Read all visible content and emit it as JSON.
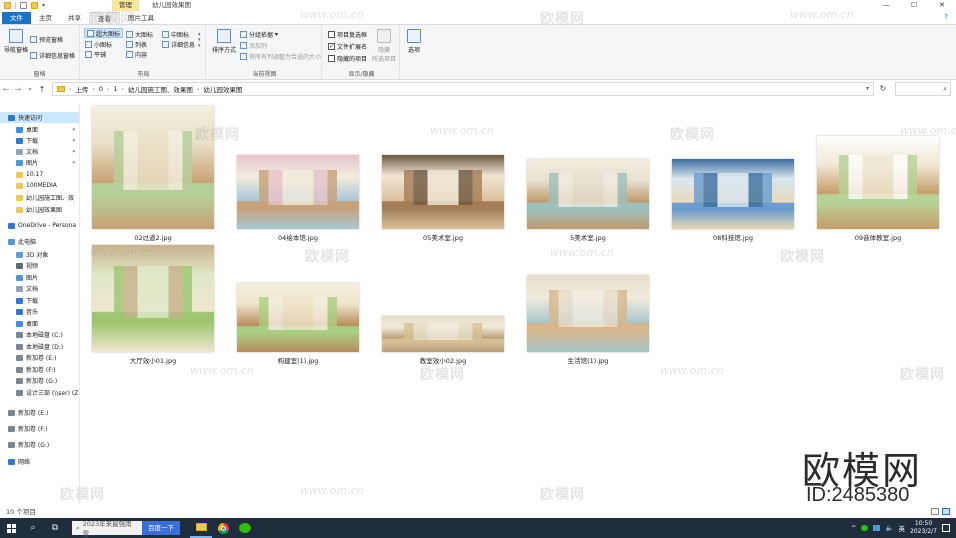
{
  "window": {
    "title": "幼儿园效果图",
    "manage_tab": "管理",
    "controls": [
      "—",
      "☐",
      "✕"
    ]
  },
  "ribbon": {
    "tabs": [
      "文件",
      "主页",
      "共享",
      "查看",
      "图片工具"
    ],
    "active_tab": "查看",
    "help": "?",
    "groups": {
      "pane": {
        "label": "窗格",
        "nav_pane": "导航窗格",
        "preview": "预览窗格",
        "details": "详细信息窗格"
      },
      "layout": {
        "label": "布局",
        "items": [
          "超大图标",
          "大图标",
          "中图标",
          "小图标",
          "列表",
          "详细信息",
          "平铺",
          "内容"
        ],
        "selected": "超大图标"
      },
      "current_view": {
        "label": "当前视图",
        "sort": "排序方式",
        "group_by": "分组依据",
        "add_column": "添加列",
        "fit_columns": "将所有列调整为合适的大小"
      },
      "show_hide": {
        "label": "显示/隐藏",
        "item_checkboxes": "项目复选框",
        "item_checkboxes_checked": false,
        "file_ext": "文件扩展名",
        "file_ext_checked": true,
        "hidden_items": "隐藏的项目",
        "hidden_items_checked": false,
        "hide": "隐藏",
        "hide_selected": "所选项目"
      },
      "options": {
        "label": "选项"
      }
    }
  },
  "address": {
    "breadcrumbs": [
      "上传",
      "0",
      "1",
      "幼儿园施工图、效果图",
      "幼儿园效果图"
    ],
    "search_placeholder": ""
  },
  "nav_pane": {
    "items": [
      {
        "label": "快速访问",
        "icon": "star-icon",
        "color": "#2b7bd6",
        "indent": 0,
        "active": true
      },
      {
        "label": "桌面",
        "icon": "desktop-icon",
        "color": "#3d8fe0",
        "indent": 1,
        "pinned": true
      },
      {
        "label": "下载",
        "icon": "download-icon",
        "color": "#2b7bd6",
        "indent": 1,
        "pinned": true
      },
      {
        "label": "文档",
        "icon": "document-icon",
        "color": "#8ea3b9",
        "indent": 1,
        "pinned": true
      },
      {
        "label": "图片",
        "icon": "picture-icon",
        "color": "#4a9ad8",
        "indent": 1,
        "pinned": true
      },
      {
        "label": "10.17",
        "icon": "folder-icon",
        "color": "#f3c94d",
        "indent": 1
      },
      {
        "label": "100MEDIA",
        "icon": "folder-icon",
        "color": "#f3c94d",
        "indent": 1
      },
      {
        "label": "幼儿园施工图、效",
        "icon": "folder-icon",
        "color": "#f3c94d",
        "indent": 1
      },
      {
        "label": "幼儿园效果图",
        "icon": "folder-icon",
        "color": "#f3c94d",
        "indent": 1
      },
      {
        "label": "OneDrive - Persona",
        "icon": "cloud-icon",
        "color": "#2b7bd6",
        "indent": 0
      },
      {
        "label": "此电脑",
        "icon": "computer-icon",
        "color": "#4a9ad8",
        "indent": 0
      },
      {
        "label": "3D 对象",
        "icon": "cube-icon",
        "color": "#5aa0e0",
        "indent": 1
      },
      {
        "label": "视频",
        "icon": "video-icon",
        "color": "#5a6b7c",
        "indent": 1
      },
      {
        "label": "图片",
        "icon": "picture-icon",
        "color": "#4a9ad8",
        "indent": 1
      },
      {
        "label": "文档",
        "icon": "document-icon",
        "color": "#8ea3b9",
        "indent": 1
      },
      {
        "label": "下载",
        "icon": "download-icon",
        "color": "#2b7bd6",
        "indent": 1
      },
      {
        "label": "音乐",
        "icon": "music-icon",
        "color": "#2b7bd6",
        "indent": 1
      },
      {
        "label": "桌面",
        "icon": "desktop-icon",
        "color": "#3d8fe0",
        "indent": 1
      },
      {
        "label": "本地磁盘 (C:)",
        "icon": "drive-icon",
        "color": "#7a8896",
        "indent": 1
      },
      {
        "label": "本地磁盘 (D:)",
        "icon": "drive-icon",
        "color": "#7a8896",
        "indent": 1
      },
      {
        "label": "新加卷 (E:)",
        "icon": "drive-icon",
        "color": "#7a8896",
        "indent": 1
      },
      {
        "label": "新加卷 (F:)",
        "icon": "drive-icon",
        "color": "#7a8896",
        "indent": 1
      },
      {
        "label": "新加卷 (G:)",
        "icon": "drive-icon",
        "color": "#7a8896",
        "indent": 1
      },
      {
        "label": "设计三部 (\\\\ser) (Z",
        "icon": "network-drive-icon",
        "color": "#7a8896",
        "indent": 1
      },
      {
        "label": "新加卷 (E:)",
        "icon": "drive-icon",
        "color": "#7a8896",
        "indent": 0
      },
      {
        "label": "新加卷 (F:)",
        "icon": "drive-icon",
        "color": "#7a8896",
        "indent": 0
      },
      {
        "label": "新加卷 (G:)",
        "icon": "drive-icon",
        "color": "#7a8896",
        "indent": 0
      },
      {
        "label": "网络",
        "icon": "network-icon",
        "color": "#2b7bd6",
        "indent": 0
      }
    ]
  },
  "files": [
    {
      "name": "02过道2.jpg",
      "palette": [
        "#e9e2c8",
        "#b6cf9a",
        "#c9a277",
        "#f4efe1"
      ]
    },
    {
      "name": "04绘本馆.jpg",
      "palette": [
        "#f1ebdd",
        "#c6a27a",
        "#a9c7d8",
        "#e7c3c9"
      ]
    },
    {
      "name": "05美术室.jpg",
      "palette": [
        "#efe6d2",
        "#a47d57",
        "#d9c09a",
        "#6d5842"
      ]
    },
    {
      "name": "5美术室.jpg",
      "palette": [
        "#e8e2d2",
        "#9cc1bc",
        "#bf9a6e",
        "#f2ece0"
      ]
    },
    {
      "name": "08科技馆.jpg",
      "palette": [
        "#d9e6ee",
        "#6a9ccd",
        "#e8d9b8",
        "#3c6e9f"
      ]
    },
    {
      "name": "09音体教室.jpg",
      "palette": [
        "#f0ead7",
        "#b7d296",
        "#c79d6a",
        "#ffffff"
      ]
    },
    {
      "name": "大厅效小01.jpg",
      "palette": [
        "#dfe8c8",
        "#9cc66f",
        "#f0e6cf",
        "#c7b28b"
      ]
    },
    {
      "name": "构建室(1).jpg",
      "palette": [
        "#eee5cc",
        "#a9cf82",
        "#b98c5b",
        "#f5efe0"
      ]
    },
    {
      "name": "教室效小02.jpg",
      "palette": [
        "#f1eadb",
        "#d5bf93",
        "#b8a07a",
        "#e6ddc8"
      ]
    },
    {
      "name": "生活馆(1).jpg",
      "palette": [
        "#f1ecdf",
        "#d6b78c",
        "#a7c5c8",
        "#e7ddc9"
      ]
    }
  ],
  "status": {
    "count": "10 个项目"
  },
  "taskbar": {
    "search_placeholder": "2023年来最强雨雪...",
    "search_button": "百度一下",
    "ime": "英",
    "time": "10:50",
    "date": "2023/2/7"
  },
  "watermark": {
    "brand": "欧模网",
    "url": "www.om.cn",
    "big_brand": "欧模网",
    "id": "ID:2485380"
  }
}
